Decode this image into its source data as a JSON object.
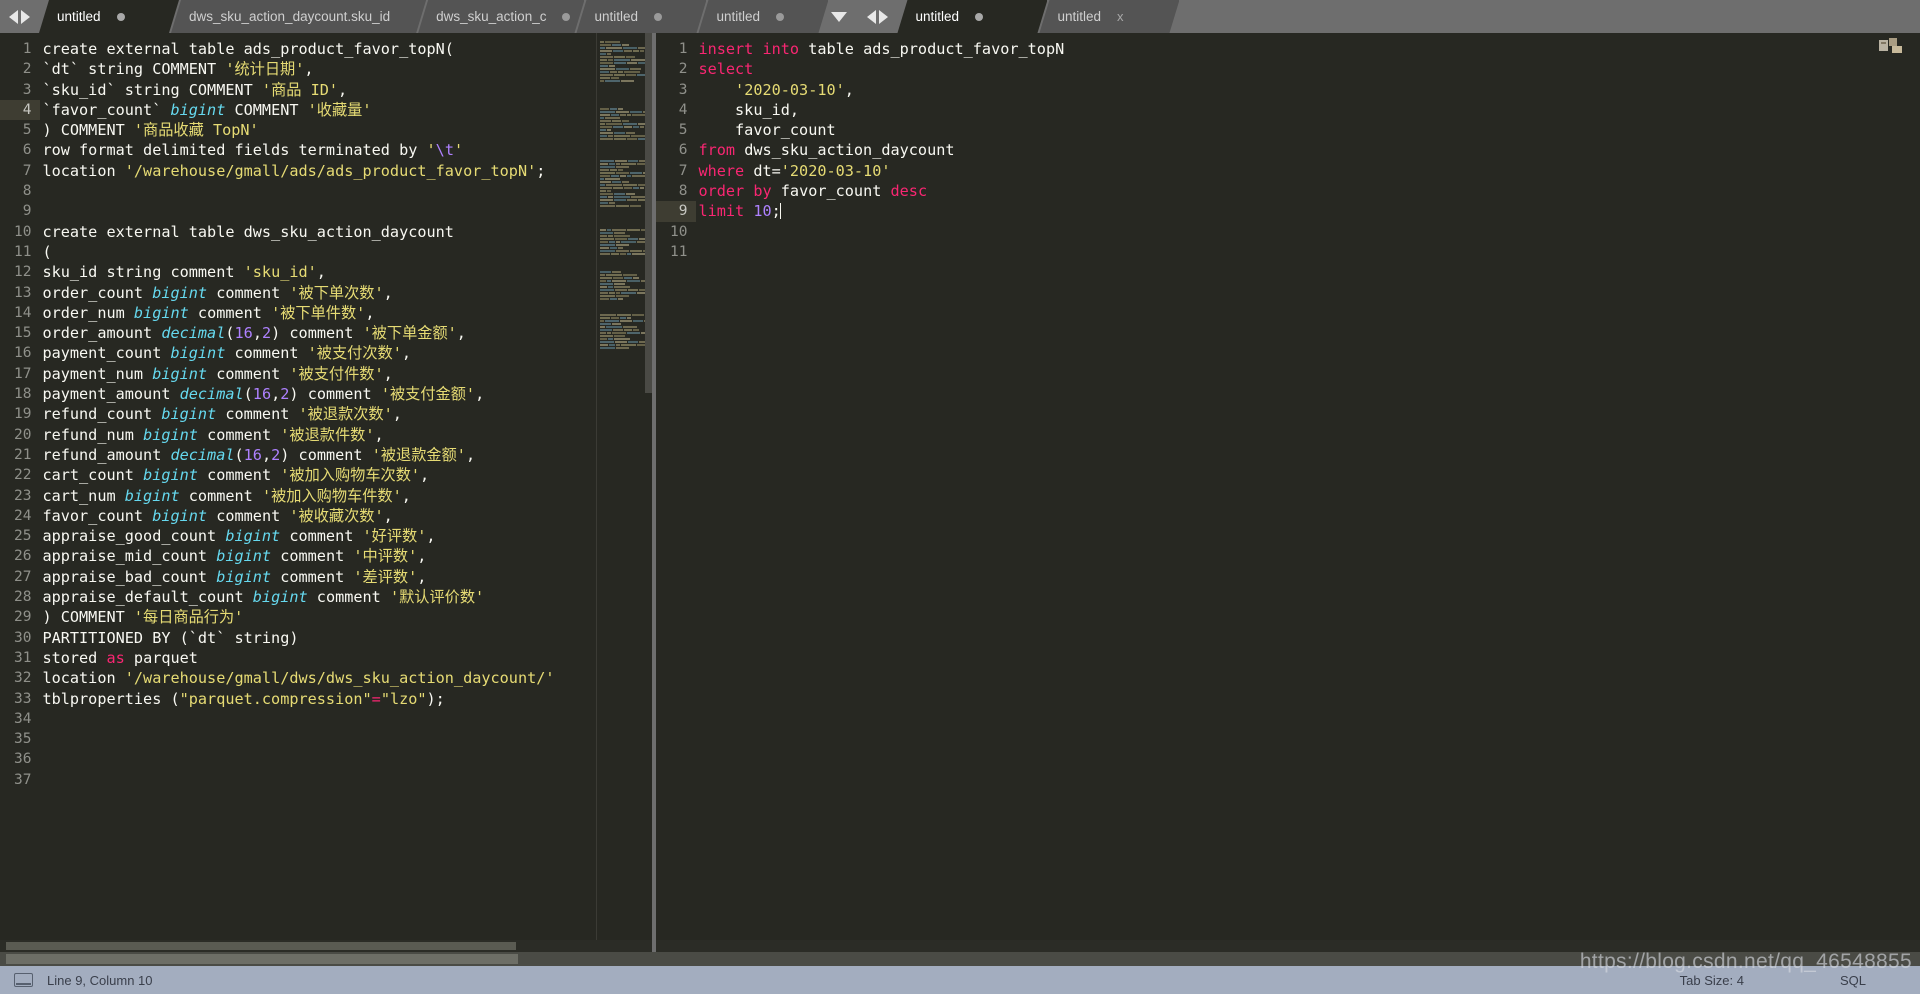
{
  "window": {
    "theme_bg": "#272822",
    "accent_keyword": "#f92672",
    "accent_string": "#e6db74",
    "accent_type": "#66d9ef",
    "accent_number": "#ae81ff",
    "tabbar_bg": "#6e6e6e",
    "statusbar_bg": "#a3adbf"
  },
  "left_group": {
    "nav_prev_icon": "chevron-left-icon",
    "nav_next_icon": "chevron-right-icon",
    "dropdown_icon": "chevron-down-icon",
    "tabs": [
      {
        "label": "untitled",
        "modified": true,
        "active": true,
        "close": ""
      },
      {
        "label": "dws_sku_action_daycount.sku_id",
        "modified": false,
        "active": false,
        "close": ""
      },
      {
        "label": "dws_sku_action_c",
        "modified": true,
        "active": false,
        "close": ""
      },
      {
        "label": "untitled",
        "modified": true,
        "active": false,
        "close": ""
      },
      {
        "label": "untitled",
        "modified": true,
        "active": false,
        "close": ""
      }
    ]
  },
  "right_group": {
    "nav_prev_icon": "chevron-left-icon",
    "nav_next_icon": "chevron-right-icon",
    "tabs": [
      {
        "label": "untitled",
        "modified": true,
        "active": true,
        "close": ""
      },
      {
        "label": "untitled",
        "modified": false,
        "active": false,
        "close": "x"
      }
    ]
  },
  "left_editor": {
    "language": "SQL",
    "first_line": 1,
    "current_line": 4,
    "lines": [
      {
        "n": 1,
        "tokens": [
          {
            "t": "create external table ads_product_favor_topN(",
            "c": "pln"
          }
        ]
      },
      {
        "n": 2,
        "tokens": [
          {
            "t": "`dt` string COMMENT ",
            "c": "pln"
          },
          {
            "t": "'统计日期'",
            "c": "str"
          },
          {
            "t": ",",
            "c": "pln"
          }
        ]
      },
      {
        "n": 3,
        "tokens": [
          {
            "t": "`sku_id` string COMMENT ",
            "c": "pln"
          },
          {
            "t": "'商品 ID'",
            "c": "str"
          },
          {
            "t": ",",
            "c": "pln"
          }
        ]
      },
      {
        "n": 4,
        "tokens": [
          {
            "t": "`favor_count` ",
            "c": "pln"
          },
          {
            "t": "bigint",
            "c": "typ"
          },
          {
            "t": " COMMENT ",
            "c": "pln"
          },
          {
            "t": "'收藏量'",
            "c": "str"
          }
        ]
      },
      {
        "n": 5,
        "tokens": [
          {
            "t": ") COMMENT ",
            "c": "pln"
          },
          {
            "t": "'商品收藏 TopN'",
            "c": "str"
          }
        ]
      },
      {
        "n": 6,
        "tokens": [
          {
            "t": "row format delimited fields terminated by ",
            "c": "pln"
          },
          {
            "t": "'",
            "c": "str"
          },
          {
            "t": "\\t",
            "c": "num"
          },
          {
            "t": "'",
            "c": "str"
          }
        ]
      },
      {
        "n": 7,
        "tokens": [
          {
            "t": "location ",
            "c": "pln"
          },
          {
            "t": "'/warehouse/gmall/ads/ads_product_favor_topN'",
            "c": "str"
          },
          {
            "t": ";",
            "c": "pln"
          }
        ]
      },
      {
        "n": 8,
        "tokens": []
      },
      {
        "n": 9,
        "tokens": []
      },
      {
        "n": 10,
        "tokens": [
          {
            "t": "create external table dws_sku_action_daycount",
            "c": "pln"
          }
        ]
      },
      {
        "n": 11,
        "tokens": [
          {
            "t": "(",
            "c": "pln"
          }
        ]
      },
      {
        "n": 12,
        "tokens": [
          {
            "t": "sku_id string comment ",
            "c": "pln"
          },
          {
            "t": "'sku_id'",
            "c": "str"
          },
          {
            "t": ",",
            "c": "pln"
          }
        ]
      },
      {
        "n": 13,
        "tokens": [
          {
            "t": "order_count ",
            "c": "pln"
          },
          {
            "t": "bigint",
            "c": "typ"
          },
          {
            "t": " comment ",
            "c": "pln"
          },
          {
            "t": "'被下单次数'",
            "c": "str"
          },
          {
            "t": ",",
            "c": "pln"
          }
        ]
      },
      {
        "n": 14,
        "tokens": [
          {
            "t": "order_num ",
            "c": "pln"
          },
          {
            "t": "bigint",
            "c": "typ"
          },
          {
            "t": " comment ",
            "c": "pln"
          },
          {
            "t": "'被下单件数'",
            "c": "str"
          },
          {
            "t": ",",
            "c": "pln"
          }
        ]
      },
      {
        "n": 15,
        "tokens": [
          {
            "t": "order_amount ",
            "c": "pln"
          },
          {
            "t": "decimal",
            "c": "typ"
          },
          {
            "t": "(",
            "c": "pln"
          },
          {
            "t": "16",
            "c": "num"
          },
          {
            "t": ",",
            "c": "pln"
          },
          {
            "t": "2",
            "c": "num"
          },
          {
            "t": ") comment ",
            "c": "pln"
          },
          {
            "t": "'被下单金额'",
            "c": "str"
          },
          {
            "t": ",",
            "c": "pln"
          }
        ]
      },
      {
        "n": 16,
        "tokens": [
          {
            "t": "payment_count ",
            "c": "pln"
          },
          {
            "t": "bigint",
            "c": "typ"
          },
          {
            "t": " comment ",
            "c": "pln"
          },
          {
            "t": "'被支付次数'",
            "c": "str"
          },
          {
            "t": ",",
            "c": "pln"
          }
        ]
      },
      {
        "n": 17,
        "tokens": [
          {
            "t": "payment_num ",
            "c": "pln"
          },
          {
            "t": "bigint",
            "c": "typ"
          },
          {
            "t": " comment ",
            "c": "pln"
          },
          {
            "t": "'被支付件数'",
            "c": "str"
          },
          {
            "t": ",",
            "c": "pln"
          }
        ]
      },
      {
        "n": 18,
        "tokens": [
          {
            "t": "payment_amount ",
            "c": "pln"
          },
          {
            "t": "decimal",
            "c": "typ"
          },
          {
            "t": "(",
            "c": "pln"
          },
          {
            "t": "16",
            "c": "num"
          },
          {
            "t": ",",
            "c": "pln"
          },
          {
            "t": "2",
            "c": "num"
          },
          {
            "t": ") comment ",
            "c": "pln"
          },
          {
            "t": "'被支付金额'",
            "c": "str"
          },
          {
            "t": ",",
            "c": "pln"
          }
        ]
      },
      {
        "n": 19,
        "tokens": [
          {
            "t": "refund_count ",
            "c": "pln"
          },
          {
            "t": "bigint",
            "c": "typ"
          },
          {
            "t": " comment ",
            "c": "pln"
          },
          {
            "t": "'被退款次数'",
            "c": "str"
          },
          {
            "t": ",",
            "c": "pln"
          }
        ]
      },
      {
        "n": 20,
        "tokens": [
          {
            "t": "refund_num ",
            "c": "pln"
          },
          {
            "t": "bigint",
            "c": "typ"
          },
          {
            "t": " comment ",
            "c": "pln"
          },
          {
            "t": "'被退款件数'",
            "c": "str"
          },
          {
            "t": ",",
            "c": "pln"
          }
        ]
      },
      {
        "n": 21,
        "tokens": [
          {
            "t": "refund_amount ",
            "c": "pln"
          },
          {
            "t": "decimal",
            "c": "typ"
          },
          {
            "t": "(",
            "c": "pln"
          },
          {
            "t": "16",
            "c": "num"
          },
          {
            "t": ",",
            "c": "pln"
          },
          {
            "t": "2",
            "c": "num"
          },
          {
            "t": ") comment ",
            "c": "pln"
          },
          {
            "t": "'被退款金额'",
            "c": "str"
          },
          {
            "t": ",",
            "c": "pln"
          }
        ]
      },
      {
        "n": 22,
        "tokens": [
          {
            "t": "cart_count ",
            "c": "pln"
          },
          {
            "t": "bigint",
            "c": "typ"
          },
          {
            "t": " comment ",
            "c": "pln"
          },
          {
            "t": "'被加入购物车次数'",
            "c": "str"
          },
          {
            "t": ",",
            "c": "pln"
          }
        ]
      },
      {
        "n": 23,
        "tokens": [
          {
            "t": "cart_num ",
            "c": "pln"
          },
          {
            "t": "bigint",
            "c": "typ"
          },
          {
            "t": " comment ",
            "c": "pln"
          },
          {
            "t": "'被加入购物车件数'",
            "c": "str"
          },
          {
            "t": ",",
            "c": "pln"
          }
        ]
      },
      {
        "n": 24,
        "tokens": [
          {
            "t": "favor_count ",
            "c": "pln"
          },
          {
            "t": "bigint",
            "c": "typ"
          },
          {
            "t": " comment ",
            "c": "pln"
          },
          {
            "t": "'被收藏次数'",
            "c": "str"
          },
          {
            "t": ",",
            "c": "pln"
          }
        ]
      },
      {
        "n": 25,
        "tokens": [
          {
            "t": "appraise_good_count ",
            "c": "pln"
          },
          {
            "t": "bigint",
            "c": "typ"
          },
          {
            "t": " comment ",
            "c": "pln"
          },
          {
            "t": "'好评数'",
            "c": "str"
          },
          {
            "t": ",",
            "c": "pln"
          }
        ]
      },
      {
        "n": 26,
        "tokens": [
          {
            "t": "appraise_mid_count ",
            "c": "pln"
          },
          {
            "t": "bigint",
            "c": "typ"
          },
          {
            "t": " comment ",
            "c": "pln"
          },
          {
            "t": "'中评数'",
            "c": "str"
          },
          {
            "t": ",",
            "c": "pln"
          }
        ]
      },
      {
        "n": 27,
        "tokens": [
          {
            "t": "appraise_bad_count ",
            "c": "pln"
          },
          {
            "t": "bigint",
            "c": "typ"
          },
          {
            "t": " comment ",
            "c": "pln"
          },
          {
            "t": "'差评数'",
            "c": "str"
          },
          {
            "t": ",",
            "c": "pln"
          }
        ]
      },
      {
        "n": 28,
        "tokens": [
          {
            "t": "appraise_default_count ",
            "c": "pln"
          },
          {
            "t": "bigint",
            "c": "typ"
          },
          {
            "t": " comment ",
            "c": "pln"
          },
          {
            "t": "'默认评价数'",
            "c": "str"
          }
        ]
      },
      {
        "n": 29,
        "tokens": [
          {
            "t": ") COMMENT ",
            "c": "pln"
          },
          {
            "t": "'每日商品行为'",
            "c": "str"
          }
        ]
      },
      {
        "n": 30,
        "tokens": [
          {
            "t": "PARTITIONED BY (`dt` string)",
            "c": "pln"
          }
        ]
      },
      {
        "n": 31,
        "tokens": [
          {
            "t": "stored ",
            "c": "pln"
          },
          {
            "t": "as",
            "c": "kw"
          },
          {
            "t": " parquet",
            "c": "pln"
          }
        ]
      },
      {
        "n": 32,
        "tokens": [
          {
            "t": "location ",
            "c": "pln"
          },
          {
            "t": "'/warehouse/gmall/dws/dws_sku_action_daycount/'",
            "c": "str"
          }
        ]
      },
      {
        "n": 33,
        "tokens": [
          {
            "t": "tblproperties (",
            "c": "pln"
          },
          {
            "t": "\"parquet.compression\"",
            "c": "str"
          },
          {
            "t": "=",
            "c": "op"
          },
          {
            "t": "\"lzo\"",
            "c": "str"
          },
          {
            "t": ");",
            "c": "pln"
          }
        ]
      },
      {
        "n": 34,
        "tokens": []
      },
      {
        "n": 35,
        "tokens": []
      },
      {
        "n": 36,
        "tokens": []
      },
      {
        "n": 37,
        "tokens": []
      }
    ]
  },
  "right_editor": {
    "language": "SQL",
    "current_line": 9,
    "lines": [
      {
        "n": 1,
        "tokens": [
          {
            "t": "insert into",
            "c": "kw"
          },
          {
            "t": " table ads_product_favor_topN",
            "c": "pln"
          }
        ]
      },
      {
        "n": 2,
        "tokens": [
          {
            "t": "select",
            "c": "kw"
          }
        ]
      },
      {
        "n": 3,
        "tokens": [
          {
            "t": "    ",
            "c": "pln"
          },
          {
            "t": "'2020-03-10'",
            "c": "str"
          },
          {
            "t": ",",
            "c": "pln"
          }
        ]
      },
      {
        "n": 4,
        "tokens": [
          {
            "t": "    sku_id,",
            "c": "pln"
          }
        ]
      },
      {
        "n": 5,
        "tokens": [
          {
            "t": "    favor_count",
            "c": "pln"
          }
        ]
      },
      {
        "n": 6,
        "tokens": [
          {
            "t": "from",
            "c": "kw"
          },
          {
            "t": " dws_sku_action_daycount",
            "c": "pln"
          }
        ]
      },
      {
        "n": 7,
        "tokens": [
          {
            "t": "where",
            "c": "kw"
          },
          {
            "t": " dt=",
            "c": "pln"
          },
          {
            "t": "'2020-03-10'",
            "c": "str"
          }
        ]
      },
      {
        "n": 8,
        "tokens": [
          {
            "t": "order",
            "c": "kw"
          },
          {
            "t": " ",
            "c": "pln"
          },
          {
            "t": "by",
            "c": "kw"
          },
          {
            "t": " favor_count ",
            "c": "pln"
          },
          {
            "t": "desc",
            "c": "kw"
          }
        ]
      },
      {
        "n": 9,
        "tokens": [
          {
            "t": "limit",
            "c": "kw"
          },
          {
            "t": " ",
            "c": "pln"
          },
          {
            "t": "10",
            "c": "num"
          },
          {
            "t": ";",
            "c": "pln"
          }
        ],
        "caret": true
      },
      {
        "n": 10,
        "tokens": []
      },
      {
        "n": 11,
        "tokens": []
      }
    ]
  },
  "statusbar": {
    "screen_icon": "monitor-icon",
    "cursor_position": "Line 9, Column 10",
    "tab_size": "Tab Size: 4",
    "language": "SQL"
  },
  "watermark": {
    "text": "https://blog.csdn.net/qq_46548855"
  }
}
